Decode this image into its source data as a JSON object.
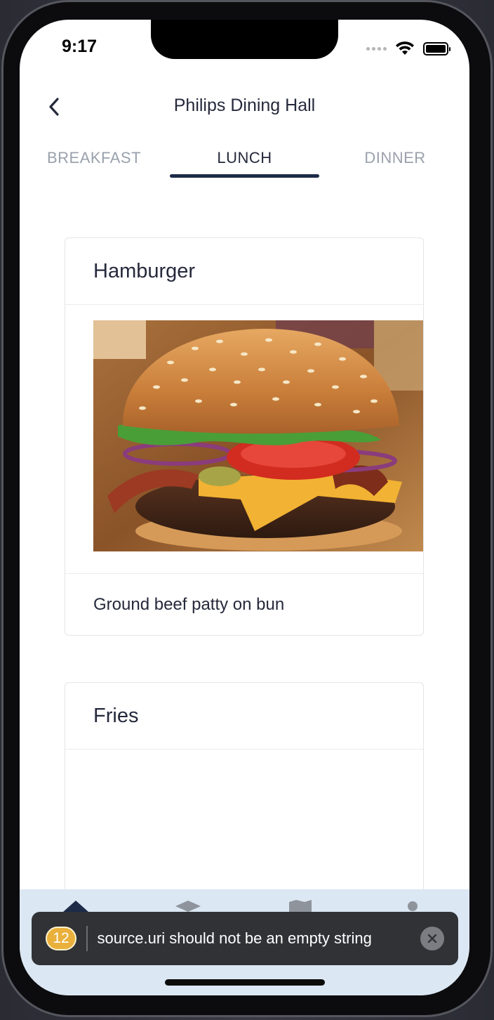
{
  "status_bar": {
    "time": "9:17"
  },
  "header": {
    "title": "Philips Dining Hall",
    "back_icon": "chevron-left-icon"
  },
  "tabs": [
    {
      "label": "BREAKFAST",
      "active": false
    },
    {
      "label": "LUNCH",
      "active": true
    },
    {
      "label": "DINNER",
      "active": false
    }
  ],
  "menu_items": [
    {
      "name": "Hamburger",
      "description": "Ground beef patty on bun",
      "image": "hamburger-photo"
    },
    {
      "name": "Fries",
      "description": "",
      "image": ""
    }
  ],
  "tab_bar": {
    "icons": [
      "home-icon",
      "graduation-cap-icon",
      "map-icon",
      "profile-icon"
    ]
  },
  "toast": {
    "count": "12",
    "message": "source.uri should not be an empty string"
  },
  "colors": {
    "accent": "#1d2b48",
    "inactive_tab": "#9aa1ad",
    "text": "#25293b",
    "tab_bar_bg": "#dbe7f3",
    "toast_bg": "#303236",
    "badge": "#e9b03c"
  }
}
